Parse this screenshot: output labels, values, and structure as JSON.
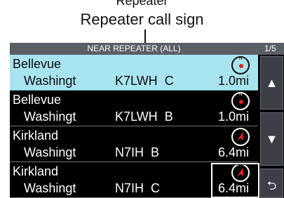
{
  "annotation": {
    "top_partial": "Repeater",
    "label": "Repeater call sign"
  },
  "screen": {
    "title": "NEAR REPEATER (ALL)",
    "page": "1/5",
    "rows": [
      {
        "name": "Bellevue",
        "state": "Washingt",
        "callsign": "K7LWH",
        "band": "C",
        "distance": "1.0mi",
        "indicator": "at-location-icon",
        "selected": true
      },
      {
        "name": "Bellevue",
        "state": "Washingt",
        "callsign": "K7LWH",
        "band": "B",
        "distance": "1.0mi",
        "indicator": "at-location-icon",
        "selected": false
      },
      {
        "name": "Kirkland",
        "state": "Washingt",
        "callsign": "N7IH",
        "band": "B",
        "distance": "6.4mi",
        "indicator": "direction-arrow-icon",
        "selected": false
      },
      {
        "name": "Kirkland",
        "state": "Washingt",
        "callsign": "N7IH",
        "band": "C",
        "distance": "6.4mi",
        "indicator": "direction-arrow-icon",
        "selected": false
      }
    ],
    "side_buttons": {
      "up": "▲",
      "down": "▼",
      "back": "⮌"
    }
  },
  "colors": {
    "selected_row": "#a8e4f0",
    "titlebar": "#5a5f66",
    "indicator_red": "#e02020"
  }
}
